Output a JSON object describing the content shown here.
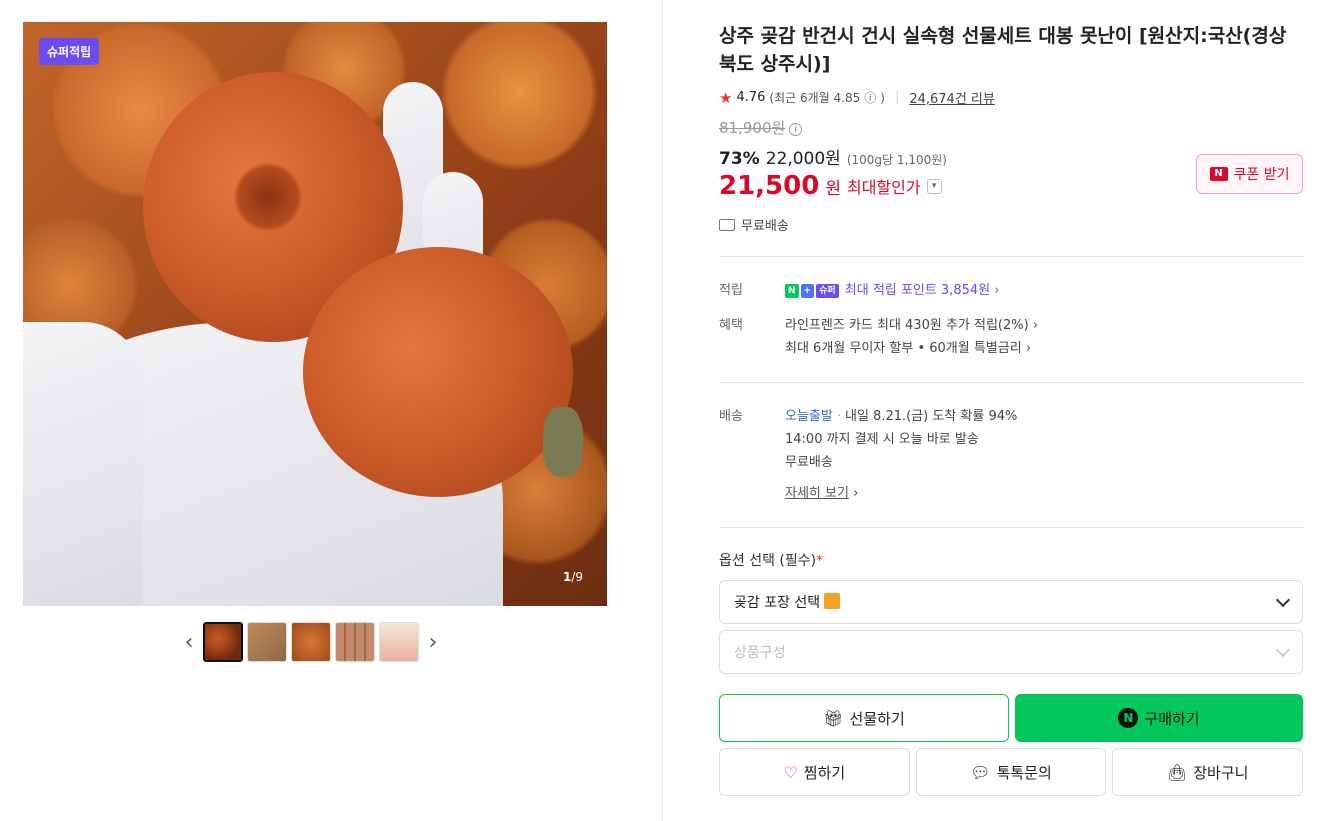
{
  "gallery": {
    "badge": "슈퍼적립",
    "counter_current": "1",
    "counter_total": "/9",
    "prev_arrow": "‹",
    "next_arrow": "›"
  },
  "product": {
    "title": "상주 곶감 반건시 건시 실속형 선물세트 대봉 못난이 [원산지:국산(경상북도 상주시)]",
    "rating": "4.76",
    "rating_recent": "(최근 6개월 4.85",
    "rating_recent_close": ")",
    "review_count": "24,674건 리뷰",
    "original_price": "81,900원",
    "discount_percent": "73%",
    "sale_price": "22,000원",
    "unit_price": "(100g당 1,100원)",
    "max_discount_price": "21,500",
    "max_discount_won": "원",
    "max_discount_label": "최대할인가",
    "coupon_label": "쿠폰 받기",
    "free_shipping": "무료배송"
  },
  "benefits": {
    "point_label": "적립",
    "point_pill_n": "N",
    "point_pill_plus": "+",
    "point_pill_super": "슈퍼",
    "point_text": "최대 적립 포인트 3,854원",
    "benefit_label": "혜택",
    "benefit_line1": "라인프렌즈 카드 최대 430원 추가 적립(2%)",
    "benefit_line2": "최대 6개월 무이자 할부 • 60개월 특별금리"
  },
  "delivery": {
    "label": "배송",
    "today": "오늘출발",
    "arrival": "내일 8.21.(금) 도착 확률 94%",
    "cutoff": "14:00 까지 결제 시 오늘 바로 발송",
    "free": "무료배송",
    "details_link": "자세히 보기"
  },
  "options": {
    "title": "옵션 선택 (필수)",
    "required_mark": "*",
    "select1": "곶감 포장 선택",
    "select2_placeholder": "상품구성"
  },
  "actions": {
    "gift": "선물하기",
    "buy": "구매하기",
    "wish": "찜하기",
    "talk": "톡톡문의",
    "cart": "장바구니"
  },
  "colors": {
    "accent_green": "#03c75a",
    "price_red": "#d40b2a",
    "super_purple": "#6a4cf0"
  }
}
